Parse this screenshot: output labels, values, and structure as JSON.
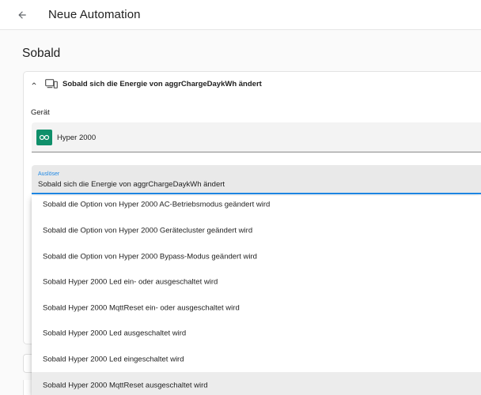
{
  "header": {
    "title": "Neue Automation"
  },
  "section": {
    "heading": "Sobald"
  },
  "card": {
    "title": "Sobald sich die Energie von aggrChargeDaykWh ändert"
  },
  "device": {
    "label": "Gerät",
    "value": "Hyper 2000"
  },
  "trigger": {
    "label": "Auslöser",
    "value": "Sobald sich die Energie von aggrChargeDaykWh ändert"
  },
  "menu": {
    "items": [
      {
        "label": "Sobald die Option von Hyper 2000 AC-Betriebsmodus geändert wird"
      },
      {
        "label": "Sobald die Option von Hyper 2000 Gerätecluster geändert wird"
      },
      {
        "label": "Sobald die Option von Hyper 2000 Bypass-Modus geändert wird"
      },
      {
        "label": "Sobald Hyper 2000 Led ein- oder ausgeschaltet wird"
      },
      {
        "label": "Sobald Hyper 2000 MqttReset ein- oder ausgeschaltet wird"
      },
      {
        "label": "Sobald Hyper 2000 Led ausgeschaltet wird"
      },
      {
        "label": "Sobald Hyper 2000 Led eingeschaltet wird"
      },
      {
        "label": "Sobald Hyper 2000 MqttReset ausgeschaltet wird"
      }
    ],
    "active_index": 7
  },
  "icons": {
    "back": "arrow-left-icon",
    "collapse": "chevron-up-icon",
    "device_type": "device-icon",
    "device_logo": "hyper-logo-icon"
  },
  "colors": {
    "accent": "#1e88e5",
    "logo_bg": "#0f8f6a",
    "field_bg": "#f3f3f3",
    "active_field_bg": "#e9e9e9"
  }
}
